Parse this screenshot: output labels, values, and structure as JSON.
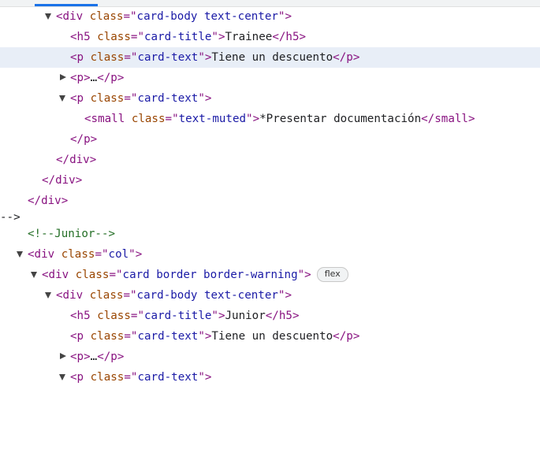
{
  "tokens": {
    "lt": "<",
    "gt": ">",
    "lt_close": "</",
    "eq_q": "=\"",
    "q_gt": "\">",
    "ellipsis": "…"
  },
  "tags": {
    "div": "div",
    "h5": "h5",
    "p": "p",
    "small": "small"
  },
  "attrs": {
    "class": "class"
  },
  "values": {
    "card_body": "card-body text-center",
    "card_title": "card-title",
    "card_text": "card-text",
    "text_muted": "text-muted",
    "col": "col",
    "card_border": "card border border-warning"
  },
  "texts": {
    "trainee": "Trainee",
    "descuento": "Tiene un descuento",
    "presentar": "*Presentar documentación"
  },
  "comment": "<!--Junior-->",
  "junior": "Junior",
  "badge": "flex",
  "colors": {
    "tag": "#881280",
    "attr": "#994500",
    "value": "#1a1aa6",
    "comment": "#236e25",
    "selected_row": "#e8eef7"
  }
}
